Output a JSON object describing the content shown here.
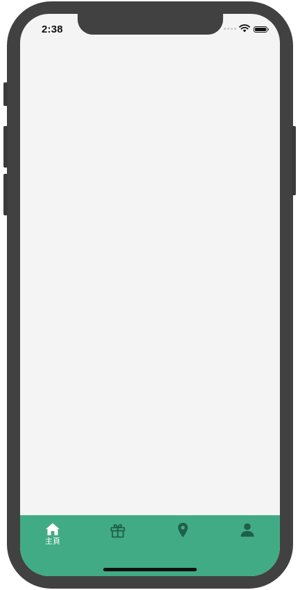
{
  "status_bar": {
    "time": "2:38"
  },
  "colors": {
    "tab_bar_background": "#41ab86",
    "active_icon": "#ffffff",
    "inactive_icon": "#1f5f4b",
    "screen_background": "#f4f4f4",
    "device_frame": "#414141"
  },
  "tab_bar": {
    "active_index": 0,
    "tabs": [
      {
        "icon": "home-icon",
        "label": "主頁"
      },
      {
        "icon": "gift-icon",
        "label": ""
      },
      {
        "icon": "map-pin-icon",
        "label": ""
      },
      {
        "icon": "user-icon",
        "label": ""
      }
    ]
  }
}
